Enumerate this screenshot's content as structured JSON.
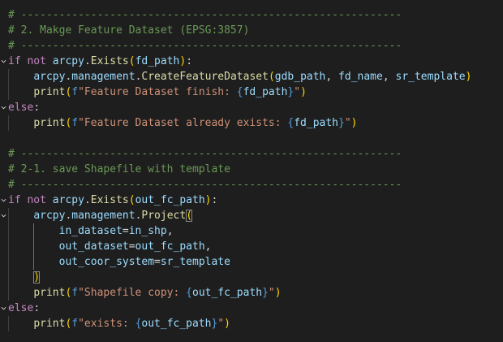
{
  "colors": {
    "background": "#1e1e1e",
    "comment": "#6a9955",
    "keyword": "#c586c0",
    "identifier": "#9cdcfe",
    "function": "#dcdcaa",
    "punctuation": "#d4d4d4",
    "string": "#ce9178",
    "fstring_prefix": "#569cd6",
    "interpolation_brace": "#569cd6",
    "bracket": "#ffd700",
    "fold_chevron": "#c5c5c5"
  },
  "icons": {
    "fold": "chevron-down-icon"
  },
  "lines": [
    {
      "fold": false,
      "indent": 0,
      "tokens": [
        {
          "t": "comment",
          "v": "# ------------------------------------------------------------"
        }
      ]
    },
    {
      "fold": false,
      "indent": 0,
      "tokens": [
        {
          "t": "comment",
          "v": "# 2. Makge Feature Dataset (EPSG:3857)"
        }
      ]
    },
    {
      "fold": false,
      "indent": 0,
      "tokens": [
        {
          "t": "comment",
          "v": "# ------------------------------------------------------------"
        }
      ]
    },
    {
      "fold": true,
      "indent": 0,
      "tokens": [
        {
          "t": "keyword",
          "v": "if"
        },
        {
          "t": "punct",
          "v": " "
        },
        {
          "t": "keyword",
          "v": "not"
        },
        {
          "t": "punct",
          "v": " "
        },
        {
          "t": "ident",
          "v": "arcpy"
        },
        {
          "t": "punct",
          "v": "."
        },
        {
          "t": "func",
          "v": "Exists"
        },
        {
          "t": "bracket",
          "v": "("
        },
        {
          "t": "ident",
          "v": "fd_path"
        },
        {
          "t": "bracket",
          "v": ")"
        },
        {
          "t": "punct",
          "v": ":"
        }
      ]
    },
    {
      "fold": false,
      "indent": 1,
      "tokens": [
        {
          "t": "ident",
          "v": "arcpy"
        },
        {
          "t": "punct",
          "v": "."
        },
        {
          "t": "ident",
          "v": "management"
        },
        {
          "t": "punct",
          "v": "."
        },
        {
          "t": "func",
          "v": "CreateFeatureDataset"
        },
        {
          "t": "bracket",
          "v": "("
        },
        {
          "t": "ident",
          "v": "gdb_path"
        },
        {
          "t": "punct",
          "v": ", "
        },
        {
          "t": "ident",
          "v": "fd_name"
        },
        {
          "t": "punct",
          "v": ", "
        },
        {
          "t": "ident",
          "v": "sr_template"
        },
        {
          "t": "bracket",
          "v": ")"
        }
      ]
    },
    {
      "fold": false,
      "indent": 1,
      "tokens": [
        {
          "t": "func",
          "v": "print"
        },
        {
          "t": "bracket",
          "v": "("
        },
        {
          "t": "prefix",
          "v": "f"
        },
        {
          "t": "string",
          "v": "\"Feature Dataset finish: "
        },
        {
          "t": "brace",
          "v": "{"
        },
        {
          "t": "ident",
          "v": "fd_path"
        },
        {
          "t": "brace",
          "v": "}"
        },
        {
          "t": "string",
          "v": "\""
        },
        {
          "t": "bracket",
          "v": ")"
        }
      ]
    },
    {
      "fold": true,
      "indent": 0,
      "tokens": [
        {
          "t": "keyword",
          "v": "else"
        },
        {
          "t": "punct",
          "v": ":"
        }
      ]
    },
    {
      "fold": false,
      "indent": 1,
      "tokens": [
        {
          "t": "func",
          "v": "print"
        },
        {
          "t": "bracket",
          "v": "("
        },
        {
          "t": "prefix",
          "v": "f"
        },
        {
          "t": "string",
          "v": "\"Feature Dataset already exists: "
        },
        {
          "t": "brace",
          "v": "{"
        },
        {
          "t": "ident",
          "v": "fd_path"
        },
        {
          "t": "brace",
          "v": "}"
        },
        {
          "t": "string",
          "v": "\""
        },
        {
          "t": "bracket",
          "v": ")"
        }
      ]
    },
    {
      "fold": false,
      "indent": 0,
      "tokens": []
    },
    {
      "fold": false,
      "indent": 0,
      "tokens": [
        {
          "t": "comment",
          "v": "# ------------------------------------------------------------"
        }
      ]
    },
    {
      "fold": false,
      "indent": 0,
      "tokens": [
        {
          "t": "comment",
          "v": "# 2-1. save Shapefile with template"
        }
      ]
    },
    {
      "fold": false,
      "indent": 0,
      "tokens": [
        {
          "t": "comment",
          "v": "# ------------------------------------------------------------"
        }
      ]
    },
    {
      "fold": true,
      "indent": 0,
      "tokens": [
        {
          "t": "keyword",
          "v": "if"
        },
        {
          "t": "punct",
          "v": " "
        },
        {
          "t": "keyword",
          "v": "not"
        },
        {
          "t": "punct",
          "v": " "
        },
        {
          "t": "ident",
          "v": "arcpy"
        },
        {
          "t": "punct",
          "v": "."
        },
        {
          "t": "func",
          "v": "Exists"
        },
        {
          "t": "bracket",
          "v": "("
        },
        {
          "t": "ident",
          "v": "out_fc_path"
        },
        {
          "t": "bracket",
          "v": ")"
        },
        {
          "t": "punct",
          "v": ":"
        }
      ]
    },
    {
      "fold": true,
      "indent": 1,
      "tokens": [
        {
          "t": "ident",
          "v": "arcpy"
        },
        {
          "t": "punct",
          "v": "."
        },
        {
          "t": "ident",
          "v": "management"
        },
        {
          "t": "punct",
          "v": "."
        },
        {
          "t": "func",
          "v": "Project"
        },
        {
          "t": "bracket-match",
          "v": "("
        }
      ]
    },
    {
      "fold": false,
      "indent": 2,
      "tokens": [
        {
          "t": "ident",
          "v": "in_dataset"
        },
        {
          "t": "punct",
          "v": "="
        },
        {
          "t": "ident",
          "v": "in_shp"
        },
        {
          "t": "punct",
          "v": ","
        }
      ]
    },
    {
      "fold": false,
      "indent": 2,
      "tokens": [
        {
          "t": "ident",
          "v": "out_dataset"
        },
        {
          "t": "punct",
          "v": "="
        },
        {
          "t": "ident",
          "v": "out_fc_path"
        },
        {
          "t": "punct",
          "v": ","
        }
      ]
    },
    {
      "fold": false,
      "indent": 2,
      "tokens": [
        {
          "t": "ident",
          "v": "out_coor_system"
        },
        {
          "t": "punct",
          "v": "="
        },
        {
          "t": "ident",
          "v": "sr_template"
        }
      ]
    },
    {
      "fold": false,
      "indent": 1,
      "tokens": [
        {
          "t": "bracket-match",
          "v": ")"
        }
      ]
    },
    {
      "fold": false,
      "indent": 1,
      "tokens": [
        {
          "t": "func",
          "v": "print"
        },
        {
          "t": "bracket",
          "v": "("
        },
        {
          "t": "prefix",
          "v": "f"
        },
        {
          "t": "string",
          "v": "\"Shapefile copy: "
        },
        {
          "t": "brace",
          "v": "{"
        },
        {
          "t": "ident",
          "v": "out_fc_path"
        },
        {
          "t": "brace",
          "v": "}"
        },
        {
          "t": "string",
          "v": "\""
        },
        {
          "t": "bracket",
          "v": ")"
        }
      ]
    },
    {
      "fold": true,
      "indent": 0,
      "tokens": [
        {
          "t": "keyword",
          "v": "else"
        },
        {
          "t": "punct",
          "v": ":"
        }
      ]
    },
    {
      "fold": false,
      "indent": 1,
      "tokens": [
        {
          "t": "func",
          "v": "print"
        },
        {
          "t": "bracket",
          "v": "("
        },
        {
          "t": "prefix",
          "v": "f"
        },
        {
          "t": "string",
          "v": "\"exists: "
        },
        {
          "t": "brace",
          "v": "{"
        },
        {
          "t": "ident",
          "v": "out_fc_path"
        },
        {
          "t": "brace",
          "v": "}"
        },
        {
          "t": "string",
          "v": "\""
        },
        {
          "t": "bracket",
          "v": ")"
        }
      ]
    }
  ]
}
